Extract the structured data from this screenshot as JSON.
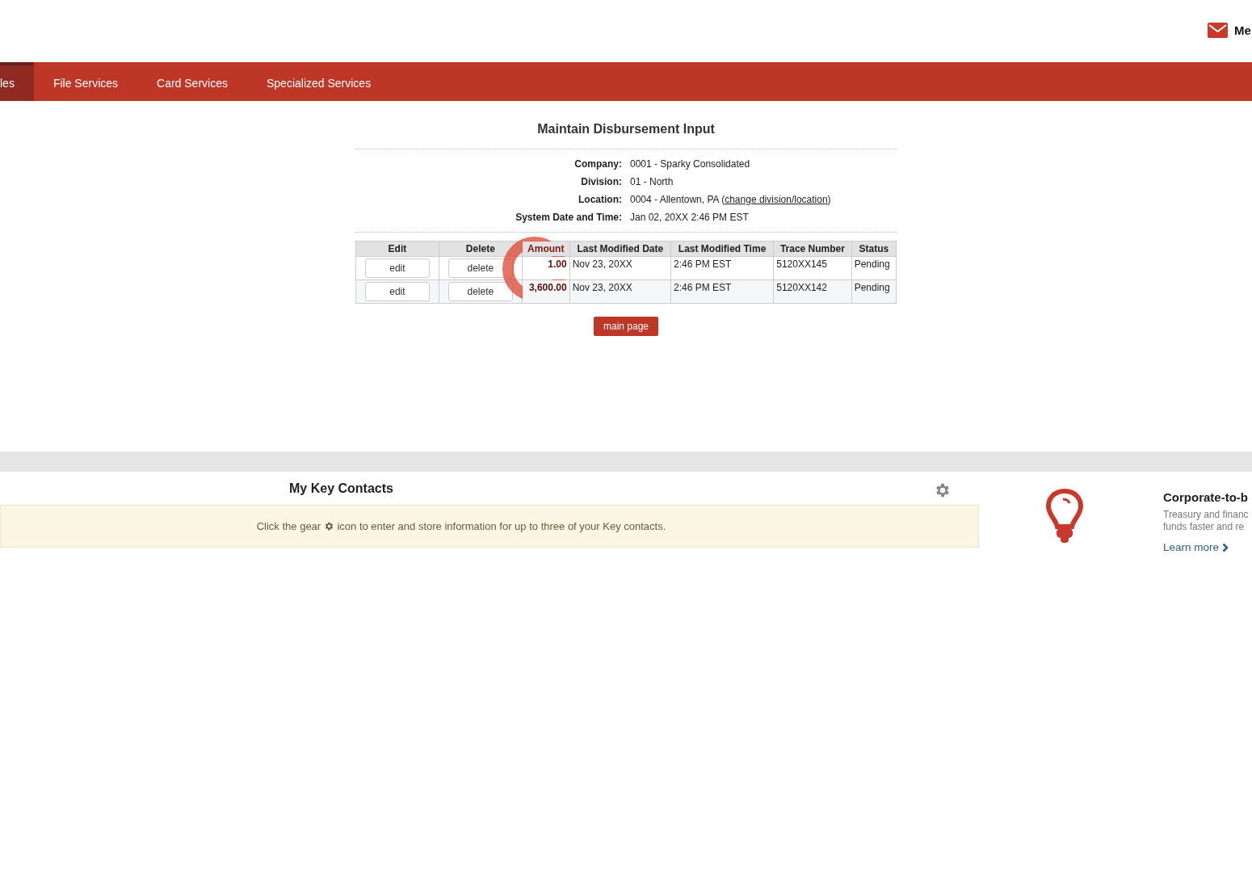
{
  "header": {
    "messages_label": "Me"
  },
  "nav": {
    "items": [
      {
        "label": "les",
        "selected": true
      },
      {
        "label": "File Services",
        "selected": false
      },
      {
        "label": "Card Services",
        "selected": false
      },
      {
        "label": "Specialized Services",
        "selected": false
      }
    ]
  },
  "page_title": "Maintain Disbursement Input",
  "info": [
    {
      "label": "Company:",
      "value": "0001 - Sparky Consolidated"
    },
    {
      "label": "Division:",
      "value": "01 - North"
    },
    {
      "label": "Location:",
      "value": "0004 - Allentown, PA (",
      "link": "change division/location",
      "suffix": ")"
    },
    {
      "label": "System Date and Time:",
      "value": "Jan 02, 20XX 2:46 PM EST"
    }
  ],
  "table": {
    "columns": [
      "Edit",
      "Delete",
      "Amount",
      "Last Modified Date",
      "Last Modified Time",
      "Trace Number",
      "Status"
    ],
    "rows": [
      {
        "edit": "edit",
        "delete": "delete",
        "amount": "1.00",
        "date": "Nov 23, 20XX",
        "time": "2:46 PM EST",
        "trace": "5120XX145",
        "status": "Pending"
      },
      {
        "edit": "edit",
        "delete": "delete",
        "amount": "3,600.00",
        "date": "Nov 23, 20XX",
        "time": "2:46 PM EST",
        "trace": "5120XX142",
        "status": "Pending"
      }
    ]
  },
  "main_button": "main page",
  "key_contacts": {
    "title": "My Key Contacts",
    "note_before": "Click the gear",
    "note_after": "icon to enter and store information for up to three of your Key contacts."
  },
  "promo": {
    "title": "Corporate-to-b",
    "lines": [
      "Treasury and financ",
      "funds faster and re"
    ],
    "link": "Learn more"
  }
}
